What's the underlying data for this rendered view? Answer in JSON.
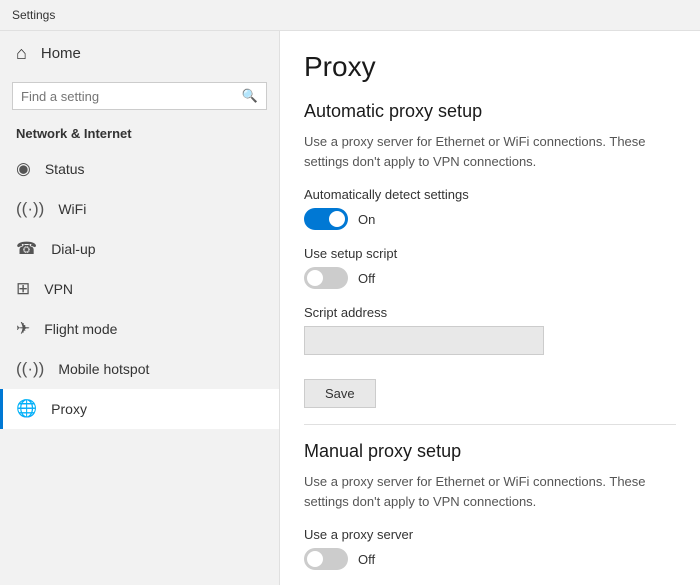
{
  "titleBar": {
    "label": "Settings"
  },
  "sidebar": {
    "home": {
      "label": "Home",
      "icon": "⌂"
    },
    "search": {
      "placeholder": "Find a setting",
      "icon": "🔍"
    },
    "sectionTitle": "Network & Internet",
    "items": [
      {
        "id": "status",
        "label": "Status",
        "icon": "◉",
        "active": false
      },
      {
        "id": "wifi",
        "label": "WiFi",
        "icon": "((·))",
        "active": false
      },
      {
        "id": "dialup",
        "label": "Dial-up",
        "icon": "☎",
        "active": false
      },
      {
        "id": "vpn",
        "label": "VPN",
        "icon": "⊞",
        "active": false
      },
      {
        "id": "flight",
        "label": "Flight mode",
        "icon": "✈",
        "active": false
      },
      {
        "id": "hotspot",
        "label": "Mobile hotspot",
        "icon": "((·))",
        "active": false
      },
      {
        "id": "proxy",
        "label": "Proxy",
        "icon": "🌐",
        "active": true
      }
    ]
  },
  "content": {
    "pageTitle": "Proxy",
    "autoSection": {
      "title": "Automatic proxy setup",
      "description": "Use a proxy server for Ethernet or WiFi connections. These settings don't apply to VPN connections.",
      "autoDetect": {
        "label": "Automatically detect settings",
        "state": "on",
        "stateLabel": "On"
      },
      "setupScript": {
        "label": "Use setup script",
        "state": "off",
        "stateLabel": "Off"
      },
      "scriptAddress": {
        "label": "Script address",
        "placeholder": "",
        "value": ""
      },
      "saveButton": "Save"
    },
    "manualSection": {
      "title": "Manual proxy setup",
      "description": "Use a proxy server for Ethernet or WiFi connections. These settings don't apply to VPN connections.",
      "useProxy": {
        "label": "Use a proxy server",
        "state": "off",
        "stateLabel": "Off"
      }
    }
  }
}
